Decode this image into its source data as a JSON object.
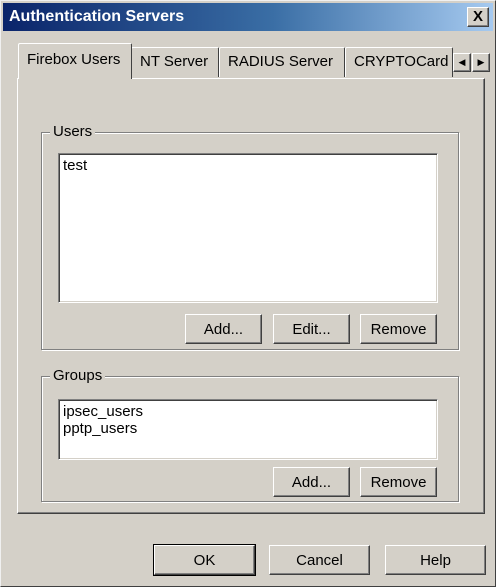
{
  "window": {
    "title": "Authentication Servers",
    "close_label": "X"
  },
  "tabs": [
    {
      "label": "Firebox Users",
      "active": true
    },
    {
      "label": "NT Server",
      "active": false
    },
    {
      "label": "RADIUS Server",
      "active": false
    },
    {
      "label": "CRYPTOCard",
      "active": false
    }
  ],
  "tab_scroll": {
    "left": "◀",
    "right": "▶"
  },
  "users": {
    "label": "Users",
    "items": [
      "test"
    ],
    "add_label": "Add...",
    "edit_label": "Edit...",
    "remove_label": "Remove"
  },
  "groups": {
    "label": "Groups",
    "items": [
      "ipsec_users",
      "pptp_users"
    ],
    "add_label": "Add...",
    "remove_label": "Remove"
  },
  "footer": {
    "ok_label": "OK",
    "cancel_label": "Cancel",
    "help_label": "Help"
  }
}
